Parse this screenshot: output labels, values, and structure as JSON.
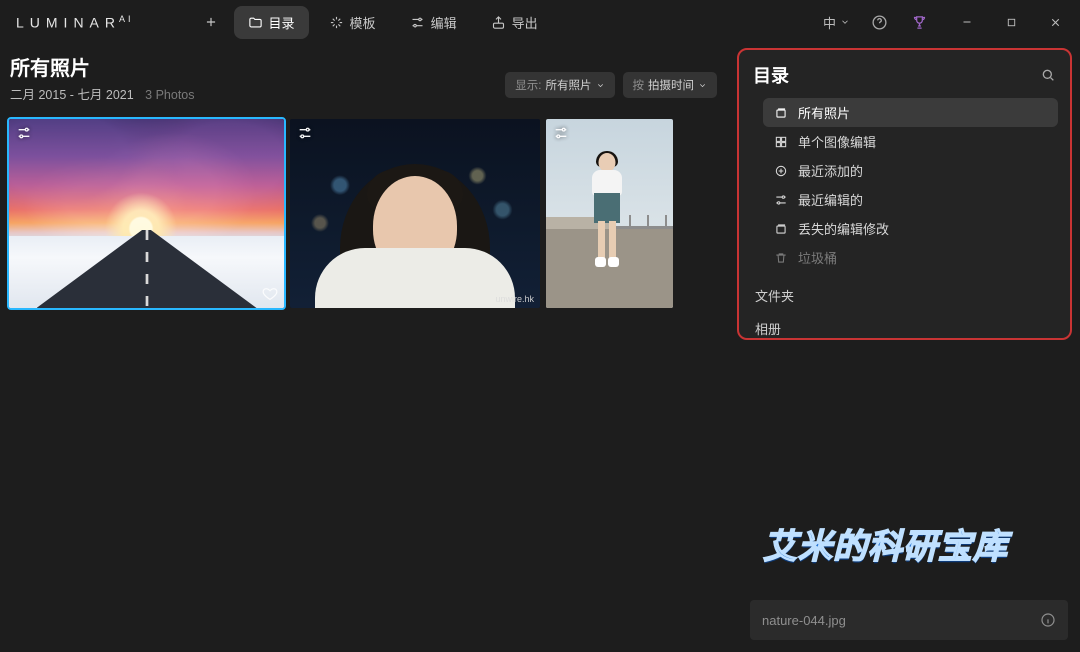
{
  "app": {
    "name": "LUMINAR",
    "edition": "AI"
  },
  "titlebar": {
    "tabs": {
      "add": "+",
      "catalog": "目录",
      "templates": "模板",
      "edit": "编辑",
      "export": "导出"
    },
    "language": "中",
    "help_tip": "?",
    "trophy_tip": "奖杯"
  },
  "header": {
    "title": "所有照片",
    "range_start": "二月 2015",
    "range_sep": " - ",
    "range_end": "七月 2021",
    "count_label": "3 Photos"
  },
  "view_controls": {
    "show_prefix": "显示:",
    "show_value": "所有照片",
    "sort_prefix": "按",
    "sort_value": "拍摄时间"
  },
  "thumbs": {
    "t2_watermark": "unwire.hk"
  },
  "panel": {
    "title": "目录",
    "items": {
      "all": "所有照片",
      "single": "单个图像编辑",
      "recent_add": "最近添加的",
      "recent_edit": "最近编辑的",
      "lost": "丢失的编辑修改",
      "trash": "垃圾桶"
    },
    "folders": "文件夹",
    "albums": "相册"
  },
  "watermark": "艾米的科研宝库",
  "filename_bar": {
    "name": "nature-044.jpg"
  }
}
